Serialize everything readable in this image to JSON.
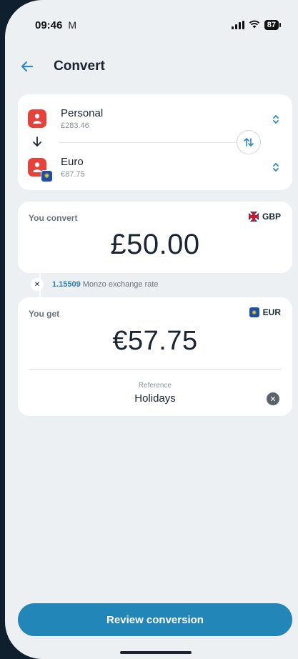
{
  "status_bar": {
    "time": "09:46",
    "mail_glyph": "M",
    "battery": "87"
  },
  "header": {
    "title": "Convert"
  },
  "accounts": {
    "from": {
      "name": "Personal",
      "balance": "£283.46"
    },
    "to": {
      "name": "Euro",
      "balance": "€87.75"
    }
  },
  "convert": {
    "label": "You convert",
    "currency": "GBP",
    "amount": "£50.00"
  },
  "rate": {
    "value": "1.15509",
    "text": "Monzo exchange rate"
  },
  "get": {
    "label": "You get",
    "currency": "EUR",
    "amount": "€57.75"
  },
  "reference": {
    "label": "Reference",
    "value": "Holidays"
  },
  "cta": {
    "label": "Review conversion"
  },
  "colors": {
    "accent": "#2386b8",
    "account_icon": "#e8413a",
    "background": "#edf0f3"
  },
  "icons": [
    "back-arrow-icon",
    "person-icon",
    "eu-flag-icon",
    "uk-flag-icon",
    "swap-icon",
    "chevron-updown-icon",
    "close-icon",
    "clear-icon"
  ]
}
